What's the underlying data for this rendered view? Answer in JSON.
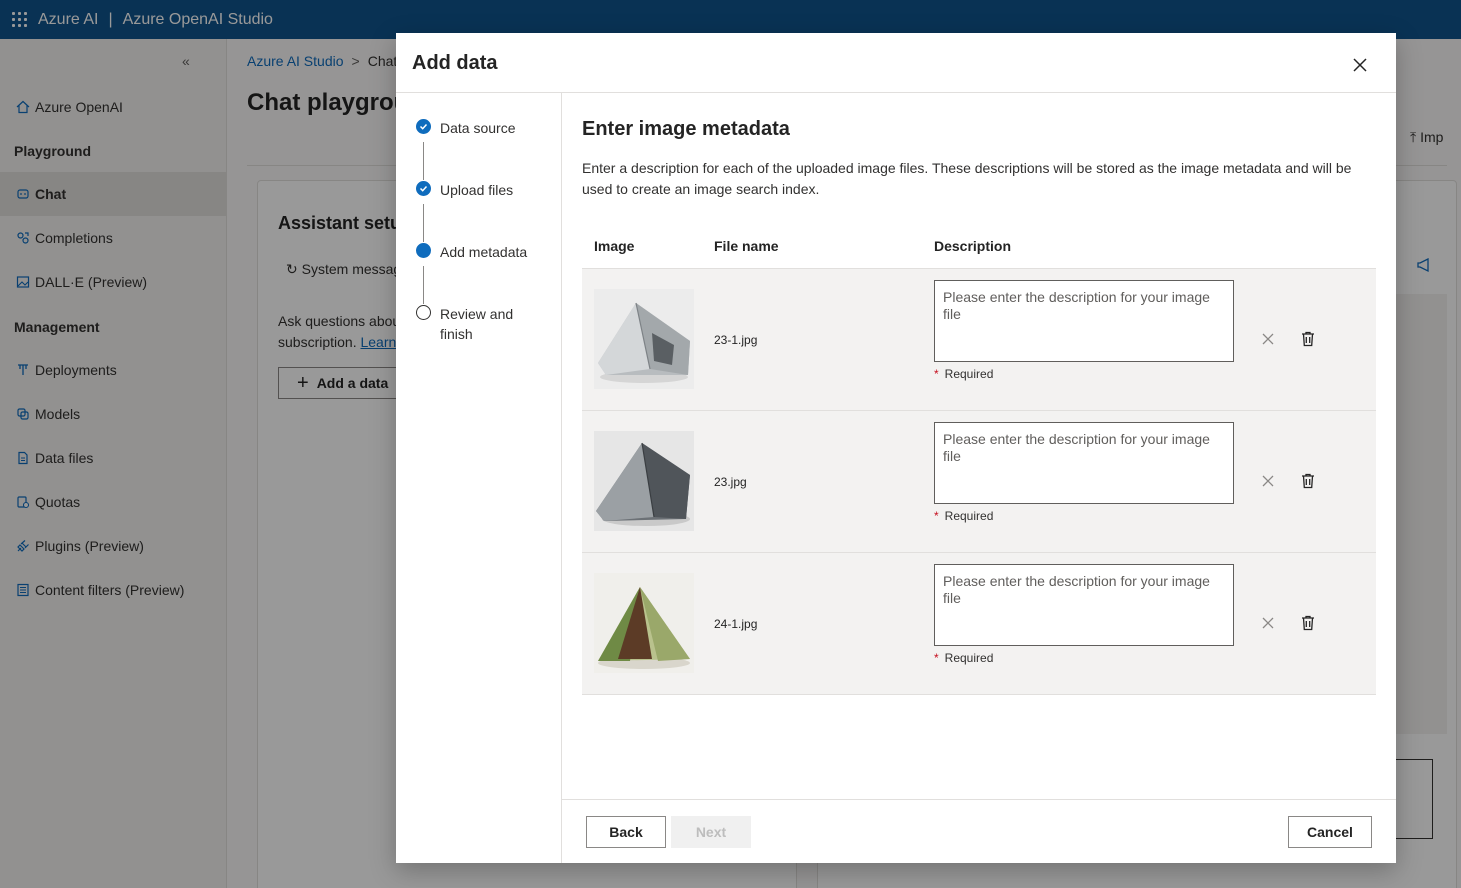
{
  "topbar": {
    "brand": "Azure AI",
    "separator": "|",
    "product": "Azure OpenAI Studio"
  },
  "sidebar": {
    "collapse": "«",
    "items": [
      {
        "label": "Azure OpenAI",
        "icon": "home-icon"
      },
      {
        "label": "Playground",
        "type": "heading"
      },
      {
        "label": "Chat",
        "icon": "chat-icon",
        "active": true
      },
      {
        "label": "Completions",
        "icon": "completions-icon"
      },
      {
        "label": "DALL·E (Preview)",
        "icon": "image-icon"
      },
      {
        "label": "Management",
        "type": "heading"
      },
      {
        "label": "Deployments",
        "icon": "deployments-icon"
      },
      {
        "label": "Models",
        "icon": "models-icon"
      },
      {
        "label": "Data files",
        "icon": "file-icon"
      },
      {
        "label": "Quotas",
        "icon": "quota-icon"
      },
      {
        "label": "Plugins (Preview)",
        "icon": "plugin-icon"
      },
      {
        "label": "Content filters (Preview)",
        "icon": "filter-icon"
      }
    ]
  },
  "breadcrumb": {
    "root": "Azure AI Studio",
    "current": "Chat"
  },
  "page": {
    "title": "Chat playgrou",
    "import": "Imp"
  },
  "assistant": {
    "title": "Assistant setup",
    "system_tab": "System messag",
    "desc_line1": "Ask questions abou",
    "desc_line2": "subscription.",
    "learn": "Learn",
    "add_data": "Add a data"
  },
  "dialog": {
    "title": "Add data",
    "steps": [
      {
        "label": "Data source",
        "state": "done"
      },
      {
        "label": "Upload files",
        "state": "done"
      },
      {
        "label": "Add metadata",
        "state": "current"
      },
      {
        "label": "Review and finish",
        "state": "todo"
      }
    ],
    "heading": "Enter image metadata",
    "intro": "Enter a description for each of the uploaded image files. These descriptions will be stored as the image metadata and will be used to create an image search index.",
    "columns": {
      "image": "Image",
      "file": "File name",
      "description": "Description"
    },
    "rows": [
      {
        "file": "23-1.jpg",
        "placeholder": "Please enter the description for your image file",
        "required": "Required",
        "tent": "gray"
      },
      {
        "file": "23.jpg",
        "placeholder": "Please enter the description for your image file",
        "required": "Required",
        "tent": "dark"
      },
      {
        "file": "24-1.jpg",
        "placeholder": "Please enter the description for your image file",
        "required": "Required",
        "tent": "green"
      }
    ],
    "buttons": {
      "back": "Back",
      "next": "Next",
      "cancel": "Cancel"
    },
    "colors": {
      "accent": "#0f6cbd",
      "required": "#c50f1f"
    }
  }
}
